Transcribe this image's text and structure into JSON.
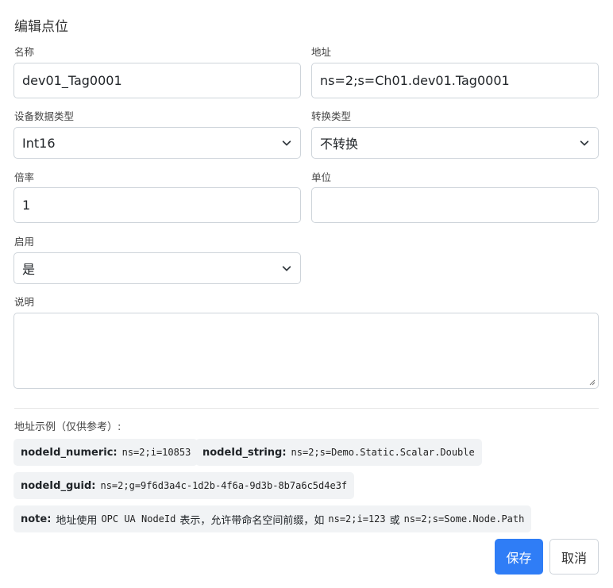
{
  "dialog": {
    "title": "编辑点位"
  },
  "form": {
    "name": {
      "label": "名称",
      "value": "dev01_Tag0001"
    },
    "address": {
      "label": "地址",
      "value": "ns=2;s=Ch01.dev01.Tag0001"
    },
    "device_data_type": {
      "label": "设备数据类型",
      "value": "Int16"
    },
    "conversion_type": {
      "label": "转换类型",
      "value": "不转换"
    },
    "multiplier": {
      "label": "倍率",
      "value": "1"
    },
    "unit": {
      "label": "单位",
      "value": ""
    },
    "enabled": {
      "label": "启用",
      "value": "是"
    },
    "description": {
      "label": "说明",
      "value": ""
    }
  },
  "examples": {
    "heading": "地址示例（仅供参考）:",
    "items": [
      {
        "key": "nodeId_numeric:",
        "value": "ns=2;i=10853"
      },
      {
        "key": "nodeId_string:",
        "value": "ns=2;s=Demo.Static.Scalar.Double"
      },
      {
        "key": "nodeId_guid:",
        "value": "ns=2;g=9f6d3a4c-1d2b-4f6a-9d3b-8b7a6c5d4e3f"
      }
    ],
    "note": {
      "key": "note:",
      "t1": "地址使用",
      "c1": "OPC UA NodeId",
      "t2": "表示，允许带命名空间前缀，如",
      "c2": "ns=2;i=123",
      "t3": "或",
      "c3": "ns=2;s=Some.Node.Path"
    }
  },
  "buttons": {
    "save": "保存",
    "cancel": "取消"
  },
  "icons": {
    "select": "chevron-down-icon",
    "textarea": "resize-grip-icon"
  }
}
